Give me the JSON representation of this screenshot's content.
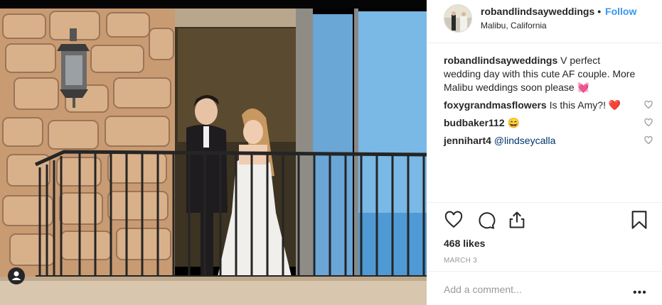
{
  "post": {
    "username": "robandlindsayweddings",
    "separator": "•",
    "follow_label": "Follow",
    "location": "Malibu, California"
  },
  "comments": [
    {
      "user": "robandlindsayweddings",
      "text": "V perfect wedding day with this cute AF couple. More Malibu weddings soon please 💓"
    },
    {
      "user": "foxygrandmasflowers",
      "text": "Is this Amy?! ❤️"
    },
    {
      "user": "budbaker112",
      "text": "😄"
    },
    {
      "user": "jennihart4",
      "text": "@lindseycalla"
    }
  ],
  "likes": "468 likes",
  "date": "MARCH 3",
  "add_comment_placeholder": "Add a comment...",
  "more_label": "•••",
  "icons": {
    "like": "heart-icon",
    "comment": "comment-icon",
    "share": "share-icon",
    "save": "bookmark-icon",
    "tagged": "tagged-user-icon",
    "comment_like": "heart-outline-icon"
  }
}
